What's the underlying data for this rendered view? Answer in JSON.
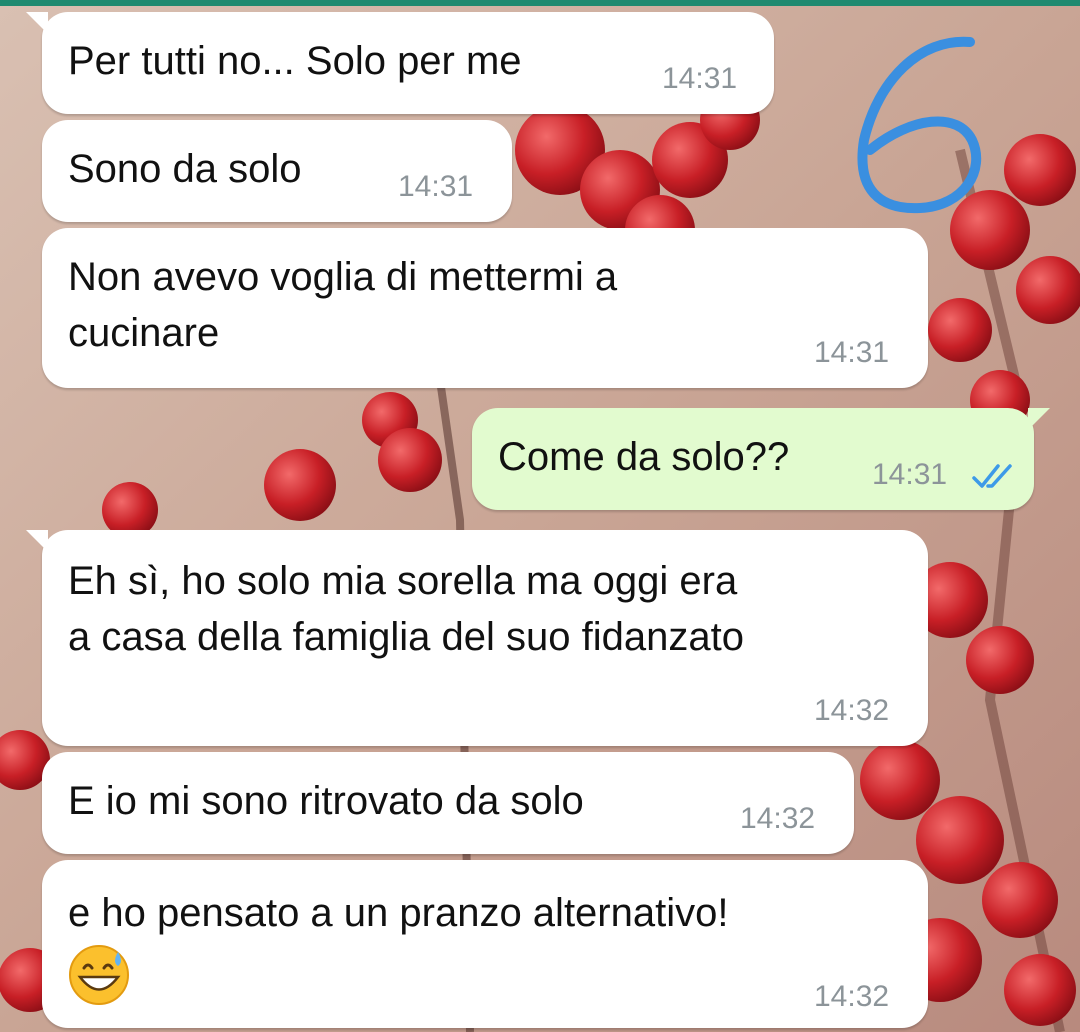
{
  "annotation": {
    "label": "6"
  },
  "colors": {
    "incoming_bubble": "#ffffff",
    "outgoing_bubble": "#e2fbcf",
    "timestamp": "#8c9499",
    "read_ticks": "#3d9ae8",
    "annotation": "#3a8fe0"
  },
  "messages": [
    {
      "direction": "incoming",
      "text": "Per tutti no... Solo per me",
      "time": "14:31"
    },
    {
      "direction": "incoming",
      "text": "Sono da solo",
      "time": "14:31"
    },
    {
      "direction": "incoming",
      "lines": [
        "Non avevo voglia di mettermi a",
        "cucinare"
      ],
      "time": "14:31"
    },
    {
      "direction": "outgoing",
      "text": "Come da solo??",
      "time": "14:31",
      "status_icon": "double-check-read-icon"
    },
    {
      "direction": "incoming",
      "lines": [
        "Eh sì, ho solo mia sorella ma oggi era",
        "a casa della famiglia del suo fidanzato"
      ],
      "time": "14:32"
    },
    {
      "direction": "incoming",
      "text": "E io mi sono ritrovato da solo",
      "time": "14:32"
    },
    {
      "direction": "incoming",
      "text": "e ho pensato a un pranzo alternativo!",
      "emoji": "grinning-face-with-sweat-emoji",
      "time": "14:32"
    }
  ]
}
